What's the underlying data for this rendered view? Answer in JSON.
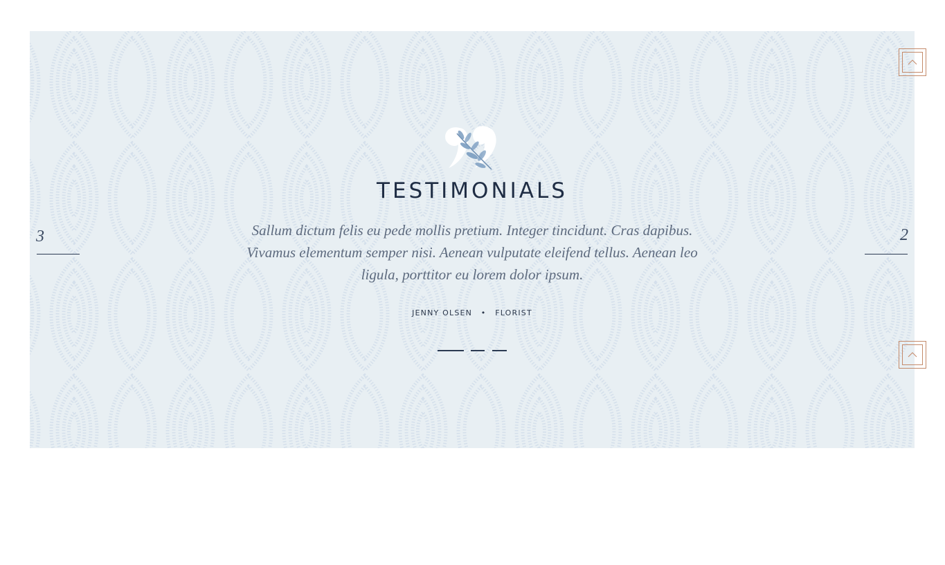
{
  "testimonials": {
    "title": "TESTIMONIALS",
    "quote": "Sallum dictum felis eu pede mollis pretium. Integer tincidunt. Cras dapibus. Vivamus elementum semper nisi. Aenean vulputate eleifend tellus. Aenean leo ligula, porttitor eu lorem dolor ipsum.",
    "author_name": "JENNY OLSEN",
    "separator": "•",
    "author_role": "FLORIST",
    "prev_number": "3",
    "next_number": "2",
    "active_slide": 1,
    "slide_count": 3
  },
  "icons": {
    "quote": "quote-leaf-icon",
    "scroll_top": "chevron-up-icon"
  },
  "colors": {
    "background": "#e8eff3",
    "title": "#1f2d44",
    "text": "#5d6a7e",
    "accent": "#c48a6a",
    "leaf": "#7a9cc0"
  }
}
